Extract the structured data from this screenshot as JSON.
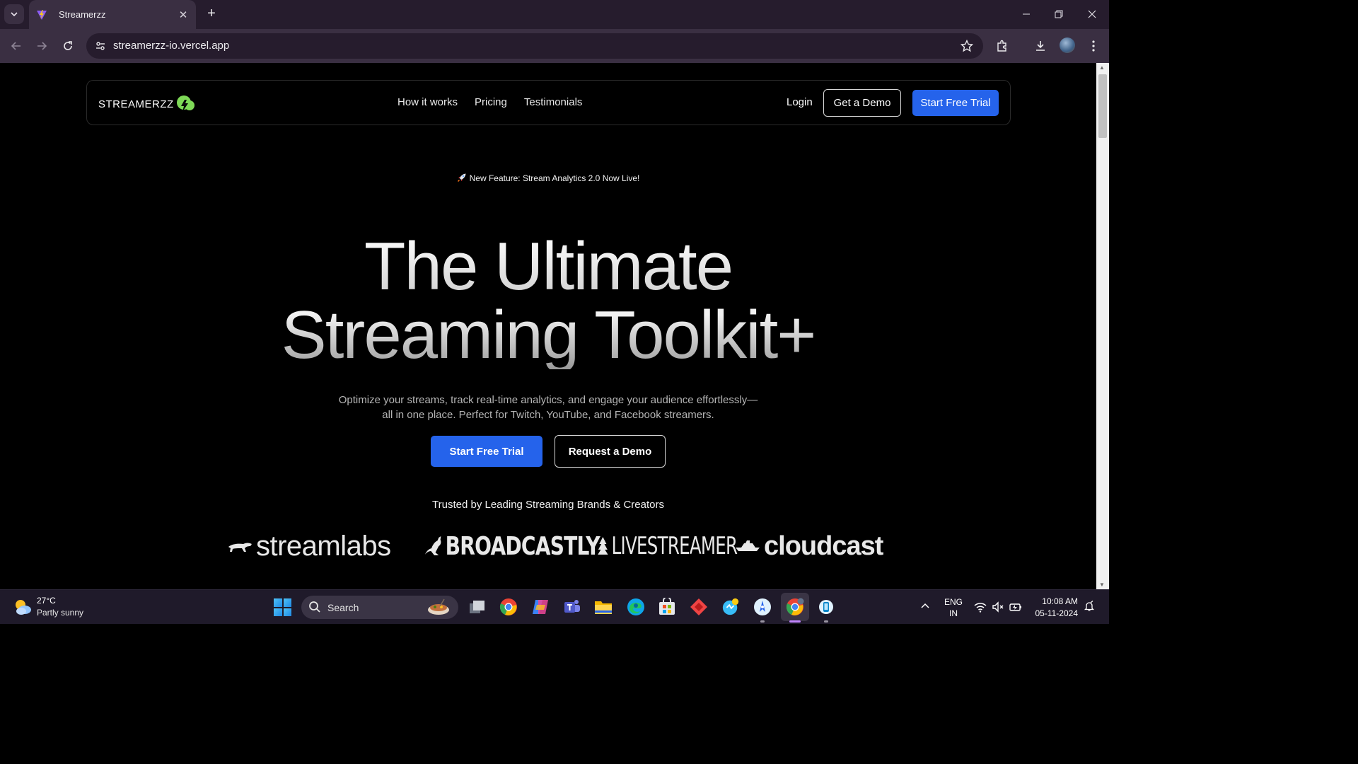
{
  "browser": {
    "tab_title": "Streamerzz",
    "url": "streamerzz-io.vercel.app"
  },
  "navbar": {
    "logo_text": "STREAMERZZ",
    "links": [
      "How it works",
      "Pricing",
      "Testimonials"
    ],
    "login_label": "Login",
    "demo_label": "Get a Demo",
    "trial_label": "Start Free Trial"
  },
  "hero": {
    "announcement": "New Feature: Stream Analytics 2.0 Now Live!",
    "title_line1": "The Ultimate",
    "title_line2": "Streaming Toolkit+",
    "subtext": "Optimize your streams, track real-time analytics, and engage your audience effortlessly—all in one place. Perfect for Twitch, YouTube, and Facebook streamers.",
    "primary_cta": "Start Free Trial",
    "secondary_cta": "Request a Demo",
    "trusted_label": "Trusted by Leading Streaming Brands & Creators"
  },
  "brands": [
    "streamlabs",
    "BROADCASTLY",
    "LIVESTREAMER",
    "cloudcast"
  ],
  "taskbar": {
    "weather_temp": "27°C",
    "weather_desc": "Partly sunny",
    "search_label": "Search",
    "lang_line1": "ENG",
    "lang_line2": "IN",
    "time": "10:08 AM",
    "date": "05-11-2024"
  },
  "colors": {
    "accent": "#2563eb",
    "logo_green": "#7ed957",
    "chrome_dark": "#261c2d",
    "chrome_mid": "#3a2f42"
  }
}
